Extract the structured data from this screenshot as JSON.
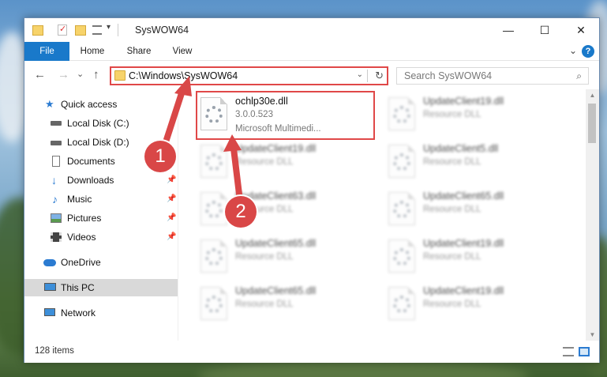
{
  "window": {
    "title": "SysWOW64",
    "controls": {
      "minimize": "—",
      "maximize": "☐",
      "close": "✕"
    }
  },
  "ribbon": {
    "tabs": [
      "File",
      "Home",
      "Share",
      "View"
    ],
    "expand": "⌄",
    "help": "?"
  },
  "address": {
    "path": "C:\\Windows\\SysWOW64",
    "dropdown": "⌄",
    "refresh": "↻"
  },
  "nav": {
    "back": "←",
    "forward": "→",
    "recent": "⌄",
    "up": "↑"
  },
  "search": {
    "placeholder": "Search SysWOW64",
    "icon": "⌕"
  },
  "sidebar": {
    "items": [
      {
        "label": "Quick access",
        "icon": "star-icon"
      },
      {
        "label": "Local Disk (C:)",
        "icon": "drive-icon"
      },
      {
        "label": "Local Disk (D:)",
        "icon": "drive-icon"
      },
      {
        "label": "Documents",
        "icon": "document-icon"
      },
      {
        "label": "Downloads",
        "icon": "download-icon"
      },
      {
        "label": "Music",
        "icon": "music-icon"
      },
      {
        "label": "Pictures",
        "icon": "picture-icon"
      },
      {
        "label": "Videos",
        "icon": "video-icon"
      },
      {
        "label": "OneDrive",
        "icon": "cloud-icon"
      },
      {
        "label": "This PC",
        "icon": "pc-icon"
      },
      {
        "label": "Network",
        "icon": "network-icon"
      }
    ],
    "pin": "📌"
  },
  "files": [
    {
      "name": "ochlp30e.dll",
      "type": "3.0.0.523",
      "desc": "Microsoft Multimedi..."
    },
    {
      "name": "UpdateClient19.dll",
      "type": "Resource DLL"
    },
    {
      "name": "UpdateClient19.dll",
      "type": "Resource DLL"
    },
    {
      "name": "UpdateClient5.dll",
      "type": "Resource DLL"
    },
    {
      "name": "UpdateClient63.dll",
      "type": "Resource DLL"
    },
    {
      "name": "UpdateClient65.dll",
      "type": "Resource DLL"
    },
    {
      "name": "UpdateClient65.dll",
      "type": "Resource DLL"
    },
    {
      "name": "UpdateClient19.dll",
      "type": "Resource DLL"
    },
    {
      "name": "UpdateClient65.dll",
      "type": "Resource DLL"
    },
    {
      "name": "UpdateClient19.dll",
      "type": "Resource DLL"
    }
  ],
  "status": {
    "count": "128 items"
  },
  "callouts": [
    "1",
    "2"
  ],
  "colors": {
    "accent": "#1979ca",
    "highlight": "#e04848",
    "callout": "#d94747"
  }
}
